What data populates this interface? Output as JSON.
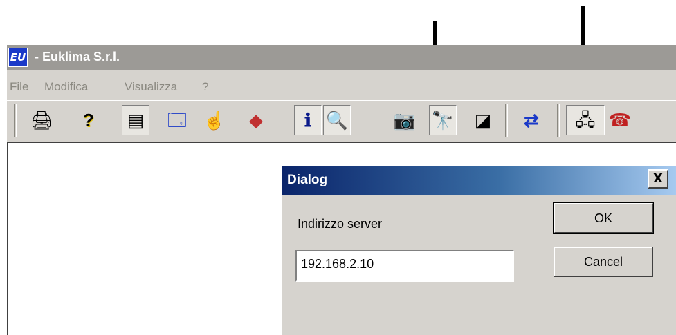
{
  "window": {
    "title": "- Euklima S.r.l.",
    "icon": "EU"
  },
  "menu": {
    "items": [
      "File",
      "Modifica",
      "Visualizza",
      "?"
    ]
  },
  "toolbar": {
    "buttons": [
      {
        "name": "print-icon",
        "glyph": "🖨"
      },
      {
        "name": "help-icon",
        "glyph": "?"
      },
      {
        "name": "form-icon",
        "glyph": "▤"
      },
      {
        "name": "window-icon",
        "glyph": "🗔"
      },
      {
        "name": "cursor-icon",
        "glyph": "☝"
      },
      {
        "name": "shapes-icon",
        "glyph": "◆"
      },
      {
        "name": "info-icon",
        "glyph": "ℹ"
      },
      {
        "name": "info-search-icon",
        "glyph": "🔍"
      },
      {
        "name": "camera-icon",
        "glyph": "📷"
      },
      {
        "name": "binoculars-icon",
        "glyph": "🔭"
      },
      {
        "name": "chart-icon",
        "glyph": "◪"
      },
      {
        "name": "transfer-icon",
        "glyph": "⇄"
      },
      {
        "name": "network-icon",
        "glyph": "🖧"
      },
      {
        "name": "phone-icon",
        "glyph": "☎"
      }
    ]
  },
  "dialog": {
    "title": "Dialog",
    "close_label": "X",
    "label": "Indirizzo server",
    "value": "192.168.2.10",
    "ok_label": "OK",
    "cancel_label": "Cancel"
  }
}
